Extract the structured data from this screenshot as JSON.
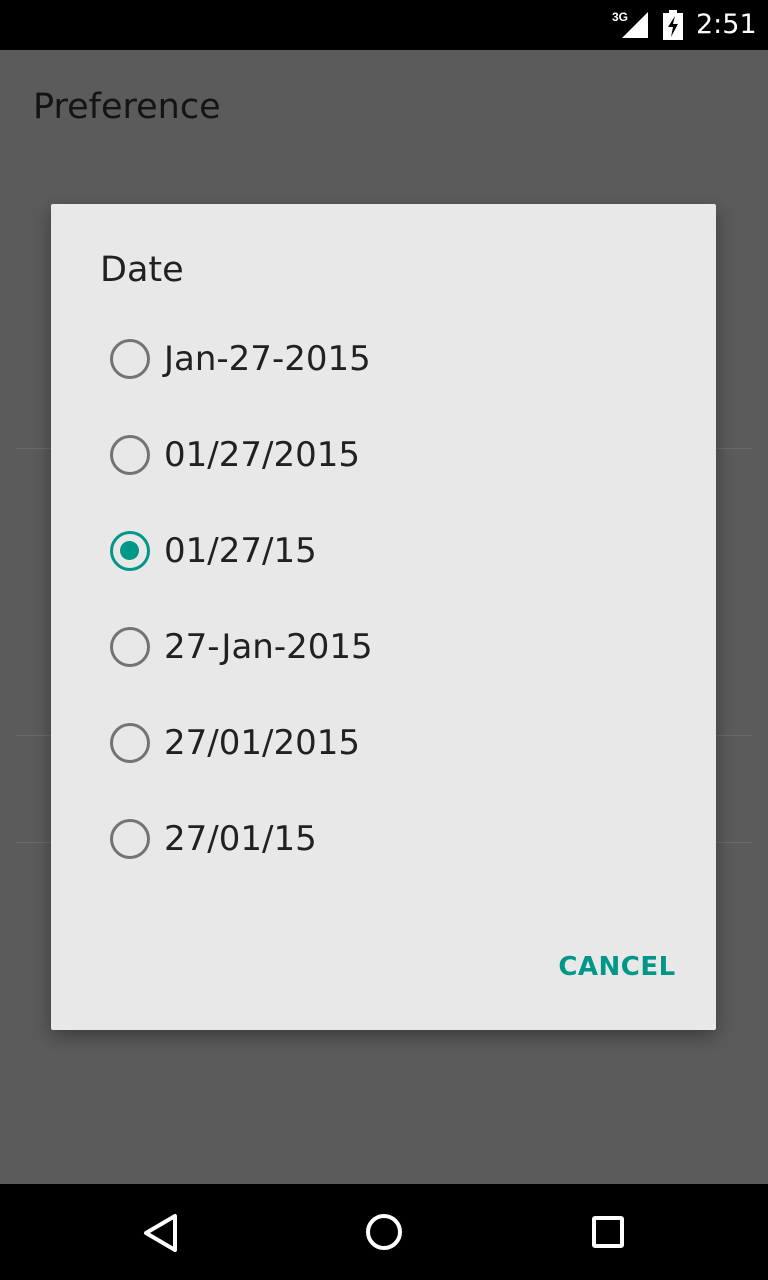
{
  "status_bar": {
    "network": "3G",
    "time": "2:51",
    "icons": [
      "signal-icon",
      "battery-icon"
    ]
  },
  "app": {
    "title": "Preference"
  },
  "dialog": {
    "title": "Date",
    "options": [
      {
        "label": "Jan-27-2015",
        "checked": false
      },
      {
        "label": "01/27/2015",
        "checked": false
      },
      {
        "label": "01/27/15",
        "checked": true
      },
      {
        "label": "27-Jan-2015",
        "checked": false
      },
      {
        "label": "27/01/2015",
        "checked": false
      },
      {
        "label": "27/01/15",
        "checked": false
      }
    ],
    "cancel_label": "CANCEL"
  },
  "nav_bar": {
    "icons": [
      "back-icon",
      "home-icon",
      "recents-icon"
    ]
  },
  "colors": {
    "accent": "#009688",
    "dialog_bg": "#e8e8e8",
    "scrim": "#5b5b5b"
  }
}
